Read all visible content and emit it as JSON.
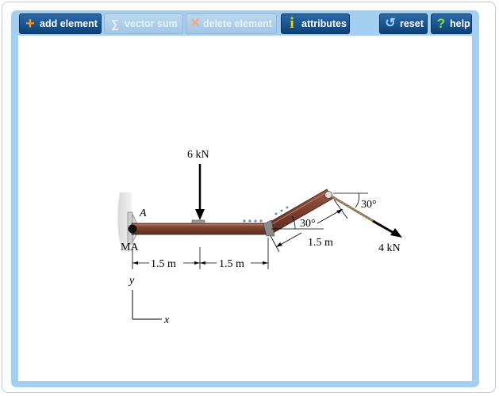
{
  "toolbar": {
    "add_label": "add element",
    "vector_sum_label": "vector sum",
    "delete_label": "delete element",
    "attributes_label": "attributes",
    "reset_label": "reset",
    "help_label": "help"
  },
  "icons": {
    "add": "plus-icon",
    "vector_sum": "sigma-icon",
    "delete": "x-icon",
    "attributes": "info-icon",
    "reset": "reset-icon",
    "help": "question-icon"
  },
  "colors": {
    "toolbar_active": "#0d4177",
    "toolbar_disabled": "#a3c7e6",
    "add_icon": "#f39a1e",
    "info_icon": "#f4d21a",
    "help_icon": "#7fe04a",
    "frame": "#a5cff0",
    "beam": "#7a3e2e"
  },
  "diagram": {
    "load_center": "6 kN",
    "load_end": "4 kN",
    "angle_beam": "30°",
    "angle_cable": "30°",
    "point_a": "A",
    "moment_label": "MA",
    "dim_1": "1.5 m",
    "dim_2": "1.5 m",
    "dim_3": "1.5 m",
    "axis_y": "y",
    "axis_x": "x"
  }
}
